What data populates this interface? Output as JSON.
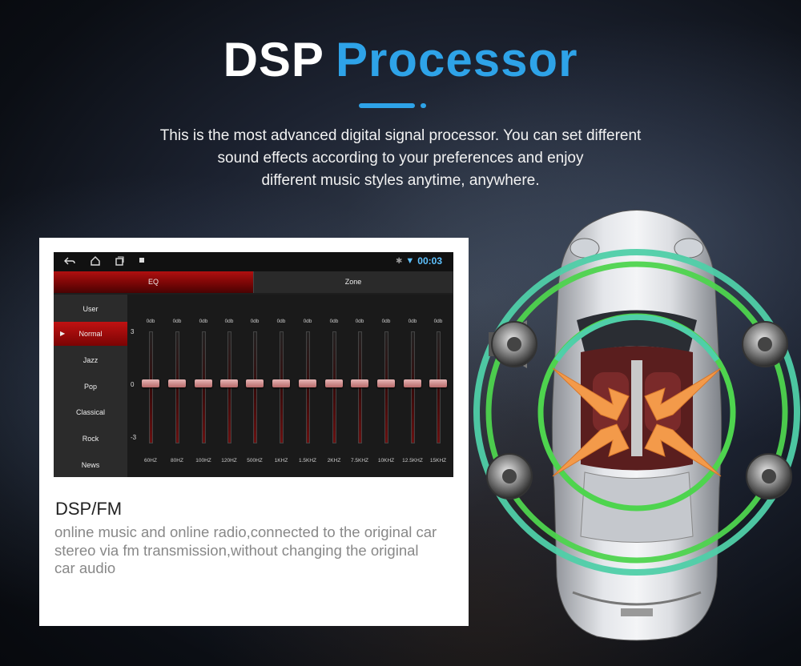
{
  "header": {
    "title_part1": "DSP",
    "title_part2": "Processor",
    "intro_line1": "This is the most advanced digital signal processor. You can set different",
    "intro_line2": "sound effects according to your preferences and enjoy",
    "intro_line3": "different music styles anytime, anywhere."
  },
  "screen": {
    "status": {
      "time": "00:03",
      "icons": [
        "back-icon",
        "home-icon",
        "recent-apps-icon",
        "notification-icon",
        "bluetooth-icon",
        "wifi-icon"
      ]
    },
    "tabs": [
      {
        "label": "EQ",
        "active": true
      },
      {
        "label": "Zone",
        "active": false
      }
    ],
    "presets": [
      {
        "label": "User"
      },
      {
        "label": "Normal",
        "active": true
      },
      {
        "label": "Jazz"
      },
      {
        "label": "Pop"
      },
      {
        "label": "Classical"
      },
      {
        "label": "Rock"
      },
      {
        "label": "News"
      }
    ],
    "scale": {
      "top": "3",
      "mid": "0",
      "bottom": "-3"
    },
    "bands": [
      {
        "db": "0db",
        "freq": "60HZ"
      },
      {
        "db": "0db",
        "freq": "80HZ"
      },
      {
        "db": "0db",
        "freq": "100HZ"
      },
      {
        "db": "0db",
        "freq": "120HZ"
      },
      {
        "db": "0db",
        "freq": "500HZ"
      },
      {
        "db": "0db",
        "freq": "1KHZ"
      },
      {
        "db": "0db",
        "freq": "1.5KHZ"
      },
      {
        "db": "0db",
        "freq": "2KHZ"
      },
      {
        "db": "0db",
        "freq": "7.5KHZ"
      },
      {
        "db": "0db",
        "freq": "10KHZ"
      },
      {
        "db": "0db",
        "freq": "12.5KHZ"
      },
      {
        "db": "0db",
        "freq": "15KHZ"
      }
    ]
  },
  "card": {
    "heading": "DSP/FM",
    "body_line1": "online music and online radio,connected to the original car",
    "body_line2": "stereo via fm transmission,without changing the original",
    "body_line3": "car audio"
  },
  "colors": {
    "accent_blue": "#2ea3e8",
    "eq_red": "#b01010",
    "ring_green": "#4ed44e",
    "ring_teal": "#4fcfa8",
    "arrow_orange": "#f39a4a"
  }
}
